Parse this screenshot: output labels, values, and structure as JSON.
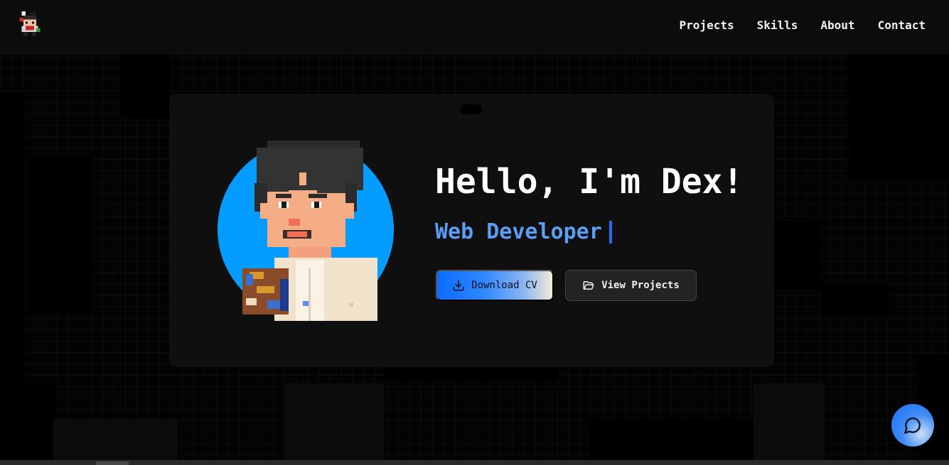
{
  "nav": {
    "logo_icon": "pixel-character-logo",
    "links": [
      "Projects",
      "Skills",
      "About",
      "Contact"
    ]
  },
  "hero": {
    "avatar_icon": "pixel-avatar-portrait",
    "greeting": "Hello, I'm Dex!",
    "role": "Web Developer",
    "download_label": "Download CV",
    "download_icon": "download-icon",
    "projects_label": "View Projects",
    "projects_icon": "folder-open-icon"
  },
  "chat": {
    "icon": "chat-bubble-icon"
  },
  "colors": {
    "accent": "#0a6cff",
    "role_text": "#5a9ef5",
    "avatar_bg": "#049cff"
  }
}
